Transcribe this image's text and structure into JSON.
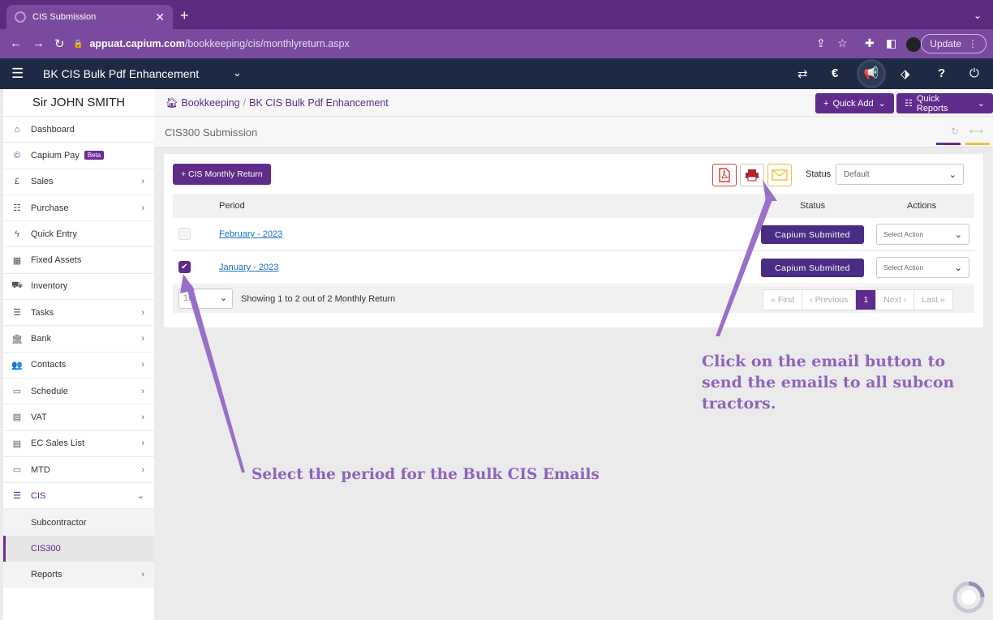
{
  "browser": {
    "tab_title": "CIS Submission",
    "url_host": "appuat.capium.com",
    "url_path": "/bookkeeping/cis/monthlyreturn.aspx",
    "update_label": "Update"
  },
  "header": {
    "company": "BK CIS Bulk Pdf Enhancement"
  },
  "sidebar": {
    "user": "Sir JOHN SMITH",
    "items": [
      {
        "label": "Dashboard",
        "icon": "home-icon"
      },
      {
        "label": "Capium Pay",
        "badge": "Beta",
        "icon": "capium-icon"
      },
      {
        "label": "Sales",
        "icon": "pound-icon"
      },
      {
        "label": "Purchase",
        "icon": "purchase-icon"
      },
      {
        "label": "Quick Entry",
        "icon": "bolt-icon"
      },
      {
        "label": "Fixed Assets",
        "icon": "building-icon"
      },
      {
        "label": "Inventory",
        "icon": "truck-icon"
      },
      {
        "label": "Tasks",
        "icon": "tasks-icon"
      },
      {
        "label": "Bank",
        "icon": "bank-icon"
      },
      {
        "label": "Contacts",
        "icon": "contacts-icon"
      },
      {
        "label": "Schedule",
        "icon": "calendar-icon"
      },
      {
        "label": "VAT",
        "icon": "calculator-icon"
      },
      {
        "label": "EC Sales List",
        "icon": "calculator-icon"
      },
      {
        "label": "MTD",
        "icon": "calendar-icon"
      },
      {
        "label": "CIS",
        "icon": "list-icon"
      },
      {
        "label": "Subcontractor"
      },
      {
        "label": "CIS300"
      },
      {
        "label": "Reports"
      }
    ]
  },
  "breadcrumb": {
    "root": "Bookkeeping",
    "current": "BK CIS Bulk Pdf Enhancement"
  },
  "toolbar": {
    "quick_add": "Quick Add",
    "quick_reports": "Quick Reports"
  },
  "page": {
    "title": "CIS300 Submission"
  },
  "card": {
    "add_button": "+ CIS Monthly Return",
    "status_label": "Status",
    "status_value": "Default",
    "columns": {
      "period": "Period",
      "status": "Status",
      "actions": "Actions"
    },
    "rows": [
      {
        "period": "February - 2023",
        "status": "Capium Submitted",
        "action": "Select Action",
        "checked": false
      },
      {
        "period": "January - 2023",
        "status": "Capium Submitted",
        "action": "Select Action",
        "checked": true
      }
    ],
    "per_page": "10",
    "showing": "Showing 1 to 2 out of 2 Monthly Return",
    "pager": {
      "first": "« First",
      "prev": "‹ Previous",
      "page": "1",
      "next": "Next ›",
      "last": "Last »"
    }
  },
  "annotations": {
    "email_note": "Click on the email button to send the emails to all subcon tractors.",
    "period_note": "Select the period for the Bulk CIS Emails"
  },
  "colors": {
    "brand_purple": "#5f2c8c",
    "header_navy": "#1e2a44",
    "annotation": "#8f63bd"
  }
}
